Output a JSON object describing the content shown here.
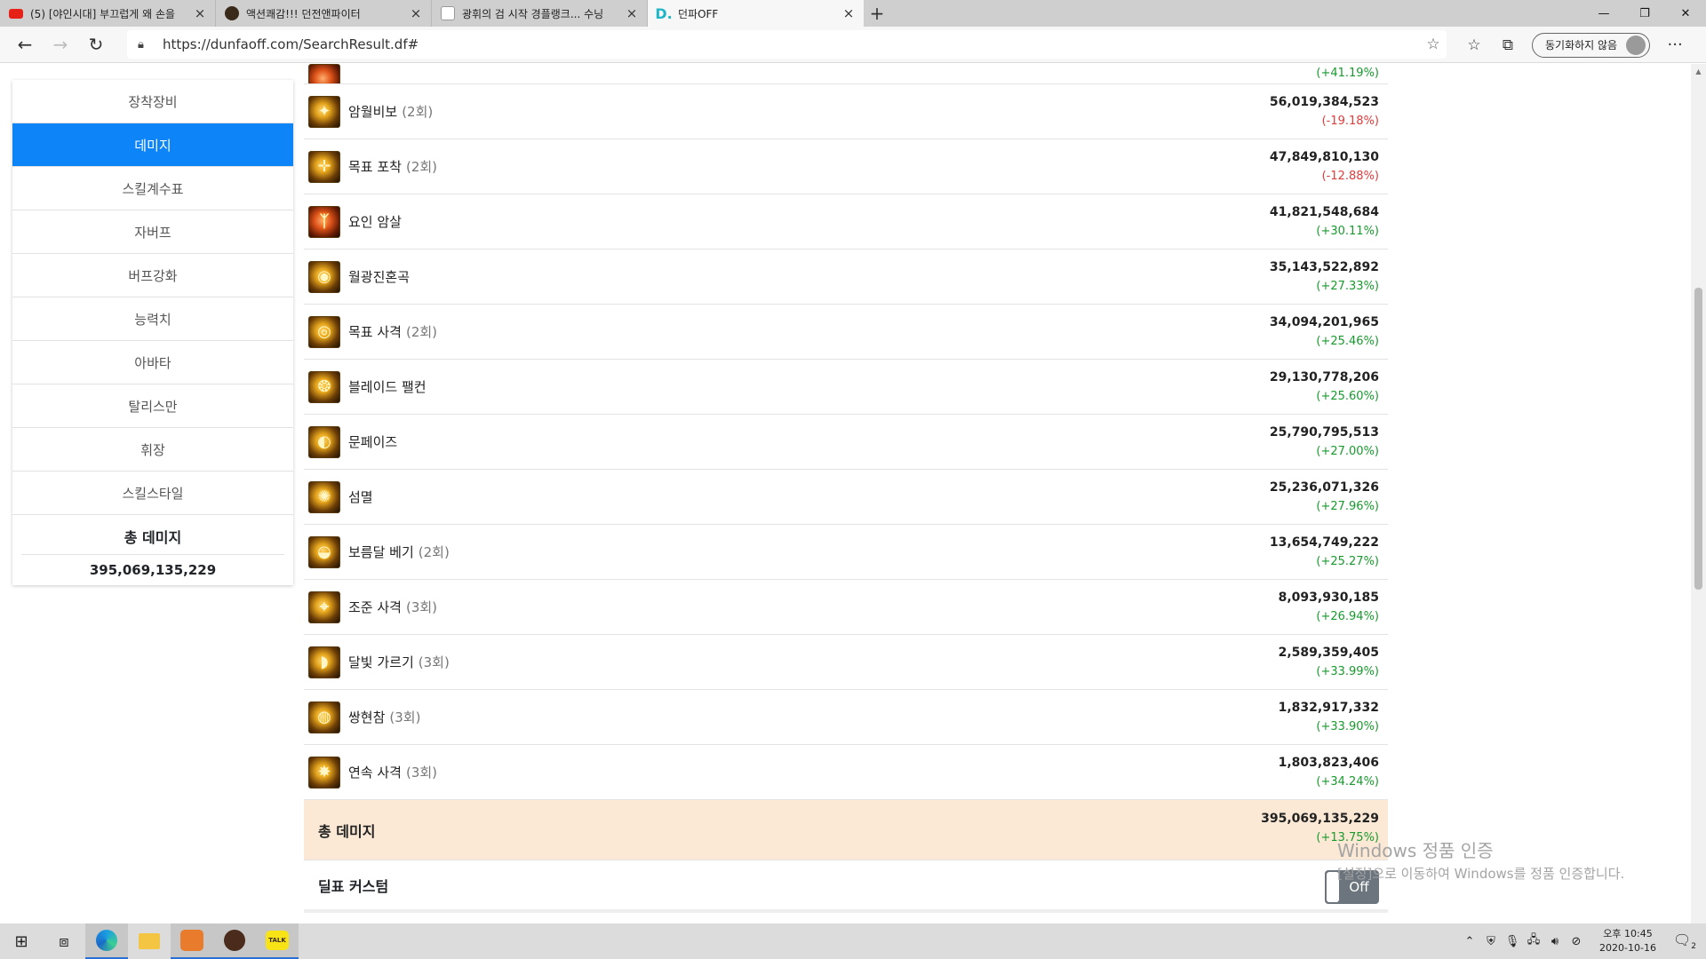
{
  "browser": {
    "tabs": [
      {
        "icon": "youtube-icon",
        "title": "(5) [야인시대] 부끄럽게 왜 손을",
        "active": false
      },
      {
        "icon": "dungeon-fighter-icon",
        "title": "액션쾌감!!! 던전앤파이터",
        "active": false
      },
      {
        "icon": "ranking-icon",
        "title": "광휘의 검 시작 경플랭크... 수닝",
        "active": false
      },
      {
        "icon": "dunfaoff-icon",
        "title": "던파OFF",
        "active": true
      }
    ],
    "url": "https://dunfaoff.com/SearchResult.df#",
    "sync_label": "동기화하지 않음"
  },
  "sidebar": {
    "items": [
      {
        "label": "장착장비",
        "active": false
      },
      {
        "label": "데미지",
        "active": true
      },
      {
        "label": "스킬계수표",
        "active": false
      },
      {
        "label": "자버프",
        "active": false
      },
      {
        "label": "버프강화",
        "active": false
      },
      {
        "label": "능력치",
        "active": false
      },
      {
        "label": "아바타",
        "active": false
      },
      {
        "label": "탈리스만",
        "active": false
      },
      {
        "label": "휘장",
        "active": false
      },
      {
        "label": "스킬스타일",
        "active": false
      }
    ],
    "total_label": "총 데미지",
    "total_value": "395,069,135,229"
  },
  "skills": {
    "partial_pct": "(+41.19%)",
    "rows": [
      {
        "name": "암월비보",
        "count": "(2회)",
        "damage": "56,019,384,523",
        "pct": "(-19.18%)",
        "trend": "down"
      },
      {
        "name": "목표 포착",
        "count": "(2회)",
        "damage": "47,849,810,130",
        "pct": "(-12.88%)",
        "trend": "down"
      },
      {
        "name": "요인 암살",
        "count": "",
        "damage": "41,821,548,684",
        "pct": "(+30.11%)",
        "trend": "up"
      },
      {
        "name": "월광진혼곡",
        "count": "",
        "damage": "35,143,522,892",
        "pct": "(+27.33%)",
        "trend": "up"
      },
      {
        "name": "목표 사격",
        "count": "(2회)",
        "damage": "34,094,201,965",
        "pct": "(+25.46%)",
        "trend": "up"
      },
      {
        "name": "블레이드 팰컨",
        "count": "",
        "damage": "29,130,778,206",
        "pct": "(+25.60%)",
        "trend": "up"
      },
      {
        "name": "문페이즈",
        "count": "",
        "damage": "25,790,795,513",
        "pct": "(+27.00%)",
        "trend": "up"
      },
      {
        "name": "섬멸",
        "count": "",
        "damage": "25,236,071,326",
        "pct": "(+27.96%)",
        "trend": "up"
      },
      {
        "name": "보름달 베기",
        "count": "(2회)",
        "damage": "13,654,749,222",
        "pct": "(+25.27%)",
        "trend": "up"
      },
      {
        "name": "조준 사격",
        "count": "(3회)",
        "damage": "8,093,930,185",
        "pct": "(+26.94%)",
        "trend": "up"
      },
      {
        "name": "달빛 가르기",
        "count": "(3회)",
        "damage": "2,589,359,405",
        "pct": "(+33.99%)",
        "trend": "up"
      },
      {
        "name": "쌍현참",
        "count": "(3회)",
        "damage": "1,832,917,332",
        "pct": "(+33.90%)",
        "trend": "up"
      },
      {
        "name": "연속 사격",
        "count": "(3회)",
        "damage": "1,803,823,406",
        "pct": "(+34.24%)",
        "trend": "up"
      }
    ]
  },
  "total": {
    "label": "총 데미지",
    "damage": "395,069,135,229",
    "pct": "(+13.75%)"
  },
  "custom": {
    "label": "딜표 커스텀",
    "toggle": "Off"
  },
  "watermark": {
    "line1": "Windows 정품 인증",
    "line2": "[설정]으로 이동하여 Windows를 정품 인증합니다."
  },
  "taskbar": {
    "time": "오후 10:45",
    "date": "2020-10-16",
    "notif_count": "2"
  }
}
